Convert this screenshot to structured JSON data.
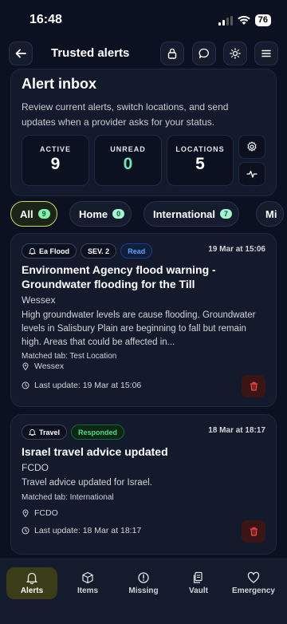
{
  "status_bar": {
    "time": "16:48",
    "battery": "76"
  },
  "header": {
    "title": "Trusted alerts",
    "icons": [
      "back-arrow-icon",
      "lock-icon",
      "chat-bubble-icon",
      "sun-icon",
      "menu-icon"
    ]
  },
  "inbox": {
    "title": "Alert inbox",
    "description": "Review current alerts, switch locations, and send updates when a provider asks for your status.",
    "stats": [
      {
        "label": "ACTIVE",
        "value": "9"
      },
      {
        "label": "UNREAD",
        "value": "0"
      },
      {
        "label": "LOCATIONS",
        "value": "5"
      }
    ]
  },
  "tabs": [
    {
      "label": "All",
      "count": "9"
    },
    {
      "label": "Home",
      "count": "0"
    },
    {
      "label": "International",
      "count": "7"
    },
    {
      "label": "Mi",
      "count": ""
    }
  ],
  "alerts": [
    {
      "provider": "Ea Flood",
      "severity": "SEV. 2",
      "status": "Read",
      "date": "19 Mar at 15:06",
      "title": "Environment Agency flood warning - Groundwater flooding for the Till",
      "source": "Wessex",
      "body": "High groundwater levels are cause flooding. Groundwater levels in Salisbury Plain are beginning to fall but remain high. Areas that could be affected in...",
      "matched_tab": "Matched tab: Test Location",
      "location": "Wessex",
      "last_update": "Last update: 19 Mar at 15:06"
    },
    {
      "provider": "Travel",
      "status": "Responded",
      "date": "18 Mar at 18:17",
      "title": "Israel travel advice updated",
      "source": "FCDO",
      "body": "Travel advice updated for Israel.",
      "matched_tab": "Matched tab: International",
      "location": "FCDO",
      "last_update": "Last update: 18 Mar at 18:17"
    }
  ],
  "bottom_nav": [
    {
      "label": "Alerts",
      "icon": "bell-icon",
      "active": true
    },
    {
      "label": "Items",
      "icon": "box-icon"
    },
    {
      "label": "Missing",
      "icon": "alert-circle-icon"
    },
    {
      "label": "Vault",
      "icon": "documents-icon"
    },
    {
      "label": "Emergency",
      "icon": "heart-icon"
    }
  ]
}
